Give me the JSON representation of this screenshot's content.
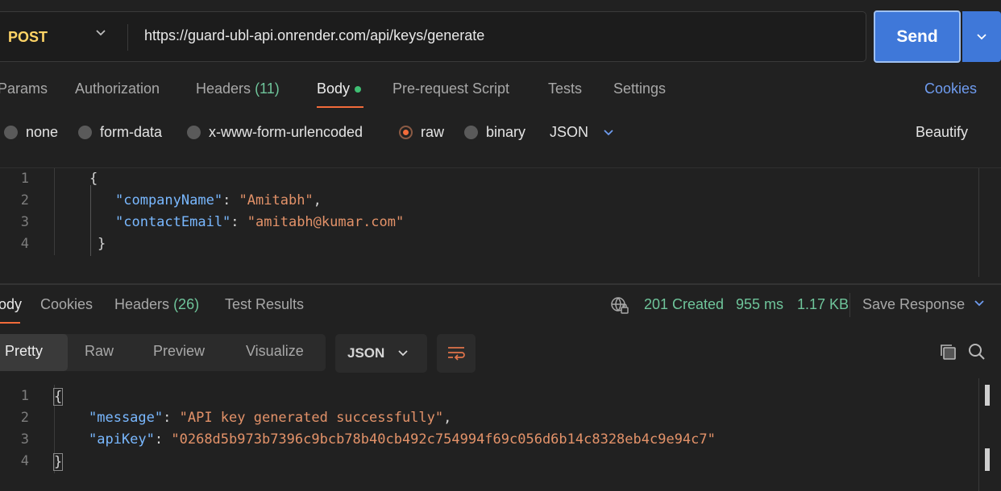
{
  "request": {
    "method": "POST",
    "url": "https://guard-ubl-api.onrender.com/api/keys/generate",
    "send_label": "Send"
  },
  "request_tabs": {
    "params": "Params",
    "authorization": "Authorization",
    "headers": "Headers",
    "headers_count": "(11)",
    "body": "Body",
    "prerequest": "Pre-request Script",
    "tests": "Tests",
    "settings": "Settings",
    "cookies": "Cookies"
  },
  "body_modes": {
    "none": "none",
    "form_data": "form-data",
    "urlencoded": "x-www-form-urlencoded",
    "raw": "raw",
    "binary": "binary",
    "format": "JSON",
    "beautify": "Beautify",
    "selected": "raw"
  },
  "request_body": {
    "line_numbers": [
      "1",
      "2",
      "3",
      "4"
    ],
    "open_brace": "{",
    "key1": "\"companyName\"",
    "val1": "\"Amitabh\"",
    "key2": "\"contactEmail\"",
    "val2": "\"amitabh@kumar.com\"",
    "close_brace": "}"
  },
  "response_tabs": {
    "body": "ody",
    "cookies": "Cookies",
    "headers": "Headers",
    "headers_count": "(26)",
    "test_results": "Test Results"
  },
  "response_status": {
    "status": "201 Created",
    "time": "955 ms",
    "size": "1.17 KB",
    "save_response": "Save Response"
  },
  "response_view": {
    "pretty": "Pretty",
    "raw": "Raw",
    "preview": "Preview",
    "visualize": "Visualize",
    "format": "JSON"
  },
  "response_body": {
    "line_numbers": [
      "1",
      "2",
      "3",
      "4"
    ],
    "open_brace": "{",
    "key1": "\"message\"",
    "val1": "\"API key generated successfully\"",
    "key2": "\"apiKey\"",
    "val2": "\"0268d5b973b7396c9bcb78b40cb492c754994f69c056d6b14c8328eb4c9e94c7\"",
    "close_brace": "}"
  },
  "colors": {
    "accent_orange": "#f26b3a",
    "send_blue": "#3f78d9",
    "status_green": "#6fc59b",
    "link_blue": "#6f9cf0",
    "method_yellow": "#ffd466"
  }
}
